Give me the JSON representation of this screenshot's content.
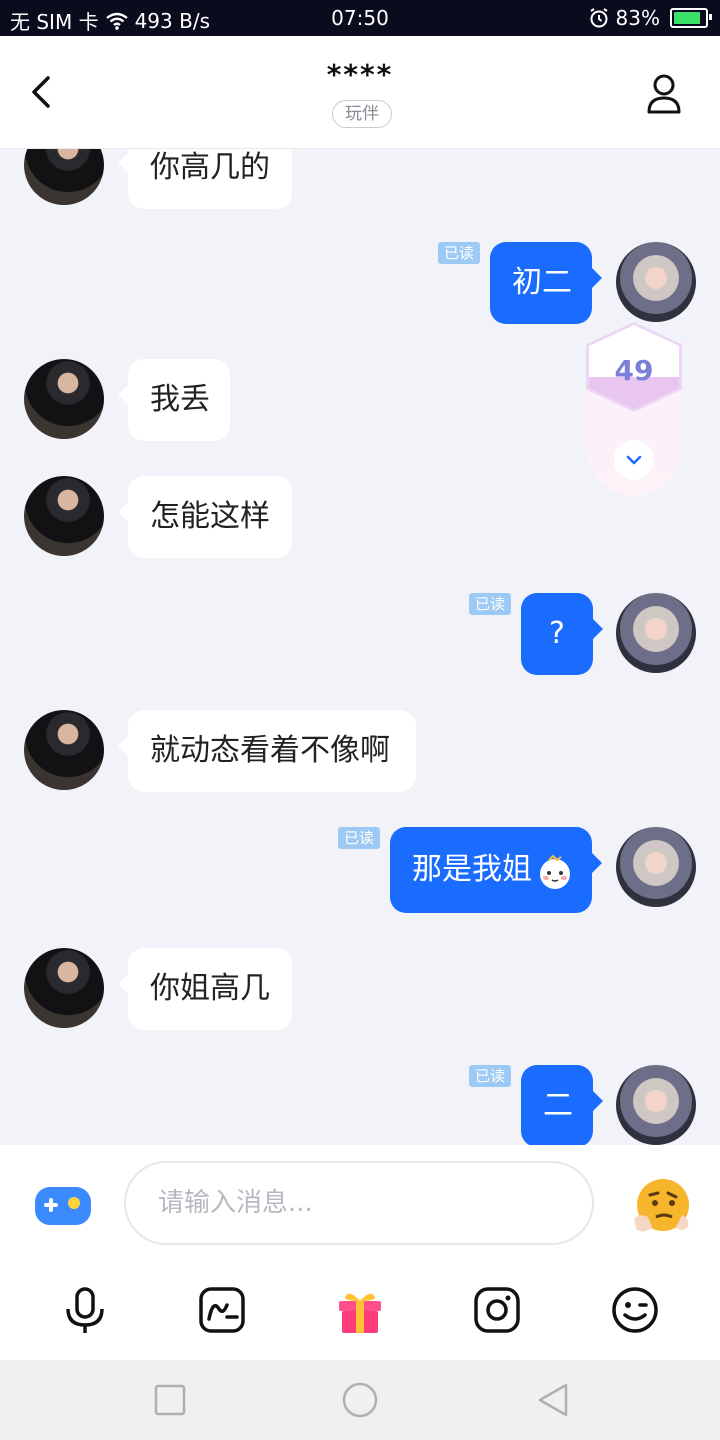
{
  "status_bar": {
    "carrier": "无 SIM 卡",
    "speed": "493 B/s",
    "time": "07:50",
    "battery": "83%"
  },
  "header": {
    "title": "****",
    "tag": "玩伴"
  },
  "messages": [
    {
      "side": "left",
      "text": "你高几的"
    },
    {
      "side": "right",
      "text": "初二",
      "read": "已读"
    },
    {
      "side": "left",
      "text": "我丢"
    },
    {
      "side": "left",
      "text": "怎能这样"
    },
    {
      "side": "right",
      "text": "?",
      "read": "已读"
    },
    {
      "side": "left",
      "text": "就动态看着不像啊"
    },
    {
      "side": "right",
      "text": "那是我姐",
      "read": "已读",
      "emoji": "sticker-face"
    },
    {
      "side": "left",
      "text": "你姐高几"
    },
    {
      "side": "right",
      "text": "二",
      "read": "已读"
    }
  ],
  "unread_counter": {
    "count": "49"
  },
  "input": {
    "placeholder": "请输入消息..."
  },
  "toolbar": [
    "mic-icon",
    "doodle-icon",
    "gift-icon",
    "camera-icon",
    "emoji-icon"
  ],
  "colors": {
    "accent": "#1a6cff",
    "read_badge": "#9ccaf4",
    "status_bar": "#0b0b1e"
  }
}
